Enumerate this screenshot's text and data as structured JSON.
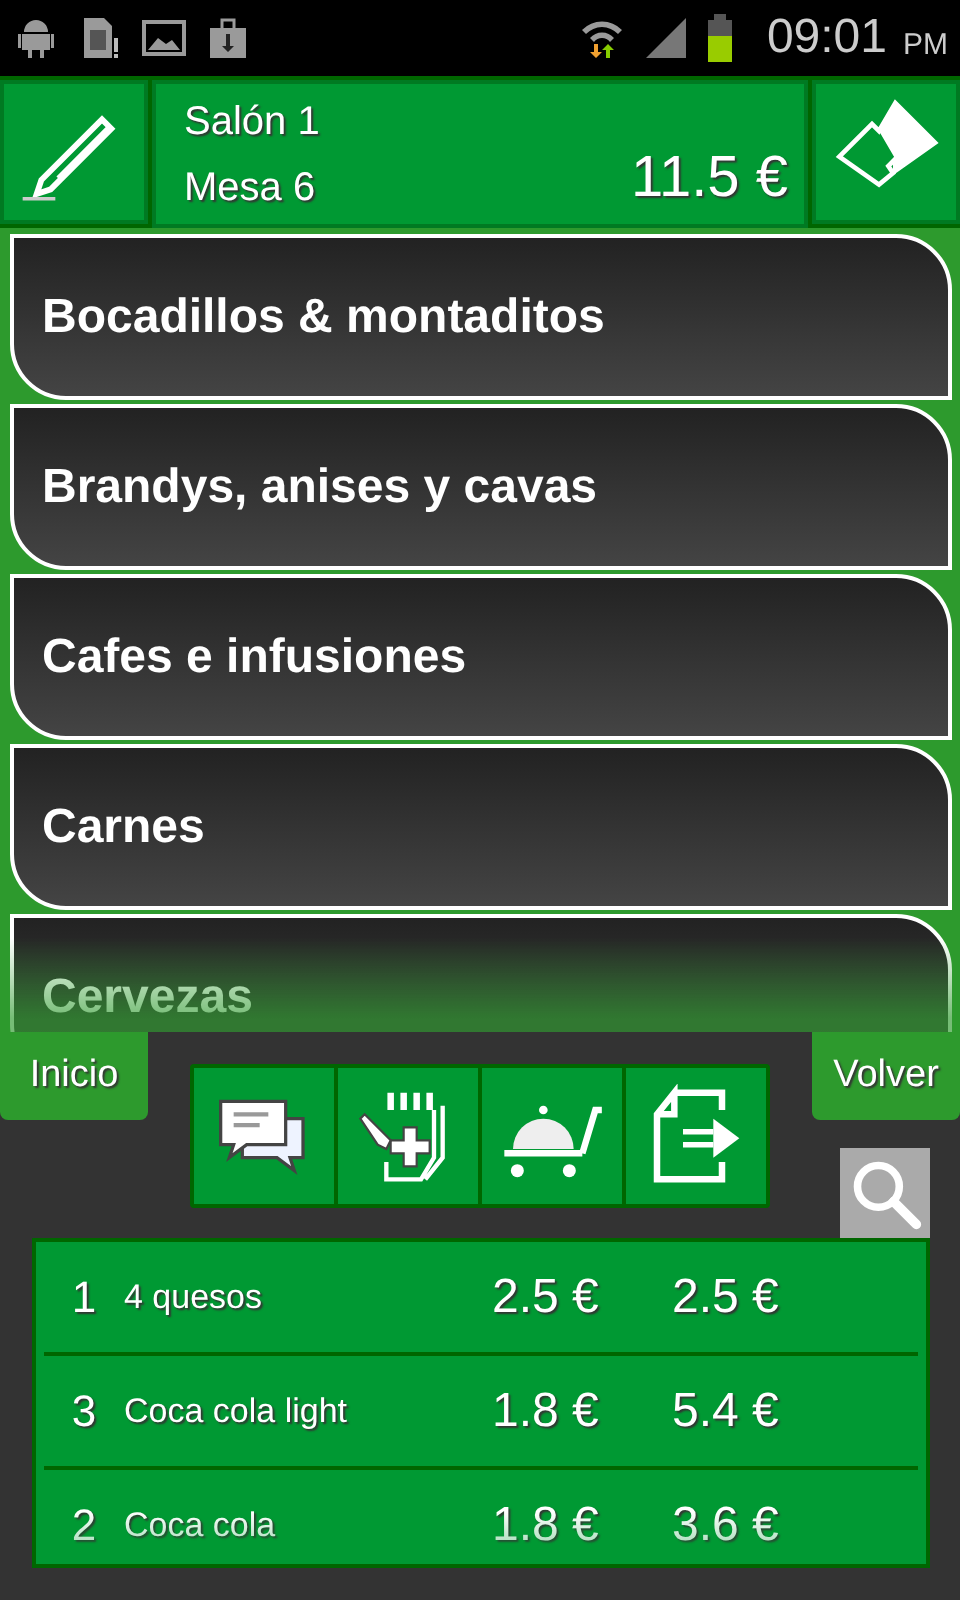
{
  "status_bar": {
    "time": "09:01",
    "ampm": "PM"
  },
  "header": {
    "room": "Salón 1",
    "table": "Mesa 6",
    "total": "11.5 €"
  },
  "categories": [
    {
      "label": "Bocadillos & montaditos"
    },
    {
      "label": "Brandys, anises y cavas"
    },
    {
      "label": "Cafes e infusiones"
    },
    {
      "label": "Carnes"
    },
    {
      "label": "Cervezas"
    }
  ],
  "nav": {
    "left": "Inicio",
    "right": "Volver"
  },
  "order_lines": [
    {
      "qty": "1",
      "name": "4 quesos",
      "price": "2.5 €",
      "amount": "2.5 €"
    },
    {
      "qty": "3",
      "name": "Coca cola light",
      "price": "1.8 €",
      "amount": "5.4 €"
    },
    {
      "qty": "2",
      "name": "Coca cola",
      "price": "1.8 €",
      "amount": "3.6 €"
    }
  ]
}
